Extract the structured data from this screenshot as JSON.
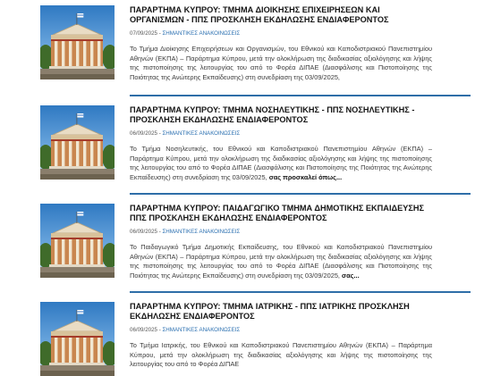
{
  "posts": [
    {
      "title": "ΠΑΡΑΡΤΗΜΑ ΚΥΠΡΟΥ: ΤΜΗΜΑ ΔΙΟΙΚΗΣΗΣ ΕΠΙΧΕΙΡΗΣΕΩΝ ΚΑΙ ΟΡΓΑΝΙΣΜΩΝ - ΠΠΣ ΠΡΟΣΚΛΗΣΗ ΕΚΔΗΛΩΣΗΣ ΕΝΔΙΑΦΕΡΟΝΤΟΣ",
      "date": "07/09/2025",
      "category": "ΣΗΜΑΝΤΙΚΕΣ ΑΝΑΚΟΙΝΩΣΕΙΣ",
      "excerpt": "Το Τμήμα Διοίκησης Επιχειρήσεων και Οργανισμών, του Εθνικού και Καποδιστριακού Πανεπιστημίου Αθηνών (ΕΚΠΑ) – Παράρτημα Κύπρου, μετά την ολοκλήρωση της διαδικασίας αξιολόγησης και λήψης της πιστοποίησης της λειτουργίας του από το Φορέα ΔΙΠΑΕ (Διασφάλισης και Πιστοποίησης της Ποιότητας της Ανώτερης Εκπαίδευσης) στη συνεδρίαση της 03/09/2025,",
      "more": ""
    },
    {
      "title": "ΠΑΡΑΡΤΗΜΑ ΚΥΠΡΟΥ: ΤΜΗΜΑ ΝΟΣΗΛΕΥΤΙΚΗΣ - ΠΠΣ ΝΟΣΗΛΕΥΤΙΚΗΣ - ΠΡΟΣΚΛΗΣΗ ΕΚΔΗΛΩΣΗΣ ΕΝΔΙΑΦΕΡΟΝΤΟΣ",
      "date": "06/09/2025",
      "category": "ΣΗΜΑΝΤΙΚΕΣ ΑΝΑΚΟΙΝΩΣΕΙΣ",
      "excerpt": "Το Τμήμα Νοσηλευτικής, του Εθνικού και Καποδιστριακού Πανεπιστημίου Αθηνών (ΕΚΠΑ) – Παράρτημα Κύπρου, μετά την ολοκλήρωση της διαδικασίας αξιολόγησης και λήψης της πιστοποίησης της λειτουργίας του από το Φορέα ΔΙΠΑΕ (Διασφάλισης και Πιστοποίησης της Ποιότητας της Ανώτερης Εκπαίδευσης) στη συνεδρίαση της 03/09/2025,",
      "more": "σας προσκαλεί όπως..."
    },
    {
      "title": "ΠΑΡΑΡΤΗΜΑ ΚΥΠΡΟΥ: ΠΑΙΔΑΓΩΓΙΚΟ ΤΜΗΜΑ ΔΗΜΟΤΙΚΗΣ ΕΚΠΑΙΔΕΥΣΗΣ ΠΠΣ ΠΡΟΣΚΛΗΣΗ ΕΚΔΗΛΩΣΗΣ ΕΝΔΙΑΦΕΡΟΝΤΟΣ",
      "date": "06/09/2025",
      "category": "ΣΗΜΑΝΤΙΚΕΣ ΑΝΑΚΟΙΝΩΣΕΙΣ",
      "excerpt": "Το Παιδαγωγικό Τμήμα Δημοτικής Εκπαίδευσης, του Εθνικού και Καποδιστριακού Πανεπιστημίου Αθηνών (ΕΚΠΑ) – Παράρτημα Κύπρου, μετά την ολοκλήρωση της διαδικασίας αξιολόγησης και λήψης της πιστοποίησης της λειτουργίας του από το Φορέα ΔΙΠΑΕ (Διασφάλισης και Πιστοποίησης της Ποιότητας της Ανώτερης Εκπαίδευσης) στη συνεδρίαση της 03/09/2025,",
      "more": "σας..."
    },
    {
      "title": "ΠΑΡΑΡΤΗΜΑ ΚΥΠΡΟΥ: ΤΜΗΜΑ ΙΑΤΡΙΚΗΣ - ΠΠΣ ΙΑΤΡΙΚΗΣ ΠΡΟΣΚΛΗΣΗ ΕΚΔΗΛΩΣΗΣ ΕΝΔΙΑΦΕΡΟΝΤΟΣ",
      "date": "06/09/2025",
      "category": "ΣΗΜΑΝΤΙΚΕΣ ΑΝΑΚΟΙΝΩΣΕΙΣ",
      "excerpt": "Το Τμήμα Ιατρικής, του Εθνικού και Καποδιστριακού Πανεπιστημίου Αθηνών (ΕΚΠΑ) – Παράρτημα Κύπρου, μετά την ολοκλήρωση της διαδικασίας αξιολόγησης και λήψης της πιστοποίησης της λειτουργίας του από το Φορέα ΔΙΠΑΕ",
      "more": ""
    }
  ],
  "colors": {
    "accent": "#2e6ea8",
    "category": "#2a6fb0",
    "title": "#151515"
  },
  "icons": {
    "thumbnail": "university-building-photo"
  }
}
